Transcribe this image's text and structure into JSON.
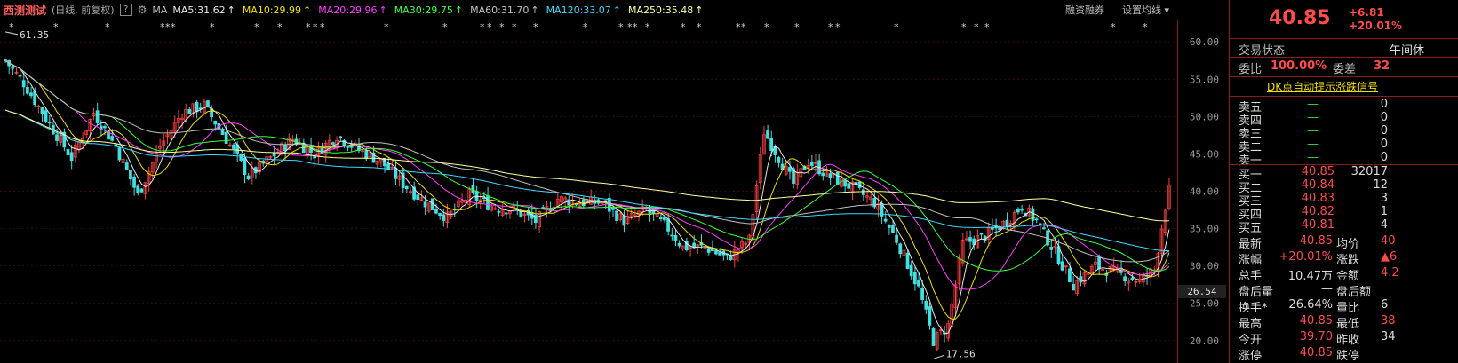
{
  "header": {
    "stock_name": "西测测试",
    "period": "(日线, 前复权)",
    "help": "?",
    "ma_label": "MA",
    "ma_items": [
      {
        "text": "MA5:31.62",
        "color": "#e8e8e8"
      },
      {
        "text": "MA10:29.99",
        "color": "#f0e000"
      },
      {
        "text": "MA20:29.96",
        "color": "#ff3cff"
      },
      {
        "text": "MA30:29.75",
        "color": "#3cff3c"
      },
      {
        "text": "MA60:31.70",
        "color": "#c0c0c0"
      },
      {
        "text": "MA120:33.07",
        "color": "#3cd8ff"
      },
      {
        "text": "MA250:35.48",
        "color": "#ffff9a"
      }
    ],
    "up_arrow": "↑",
    "margin_trading": "融资融券",
    "set_ma": "设置均线",
    "dropdown": "▾"
  },
  "chart_data": {
    "type": "candlestick",
    "ylim": [
      17,
      63
    ],
    "y_ticks": [
      "60.00",
      "55.00",
      "50.00",
      "45.00",
      "40.00",
      "35.00",
      "30.00",
      "25.00",
      "20.00"
    ],
    "current_price_label": "26.54",
    "high_annotation": "61.35",
    "low_annotation": "17.56",
    "event_marker": "*",
    "ma_series": [
      {
        "name": "MA5",
        "color": "#e8e8e8"
      },
      {
        "name": "MA10",
        "color": "#f0e000"
      },
      {
        "name": "MA20",
        "color": "#ff3cff"
      },
      {
        "name": "MA30",
        "color": "#3cff3c"
      },
      {
        "name": "MA60",
        "color": "#c0c0c0"
      },
      {
        "name": "MA120",
        "color": "#3cd8ff"
      },
      {
        "name": "MA250",
        "color": "#ffff9a"
      }
    ],
    "price_path": [
      [
        0,
        57.5
      ],
      [
        5,
        54.5
      ],
      [
        12,
        49
      ],
      [
        18,
        44.5
      ],
      [
        24,
        50.5
      ],
      [
        30,
        46
      ],
      [
        36,
        39.5
      ],
      [
        42,
        46
      ],
      [
        48,
        50.5
      ],
      [
        54,
        51.5
      ],
      [
        60,
        47
      ],
      [
        66,
        42
      ],
      [
        72,
        44.5
      ],
      [
        78,
        47
      ],
      [
        84,
        45
      ],
      [
        90,
        47.5
      ],
      [
        96,
        45.5
      ],
      [
        102,
        44
      ],
      [
        108,
        41
      ],
      [
        114,
        38.5
      ],
      [
        120,
        36.5
      ],
      [
        126,
        39.5
      ],
      [
        132,
        38
      ],
      [
        138,
        37.5
      ],
      [
        144,
        36
      ],
      [
        150,
        39
      ],
      [
        156,
        38.5
      ],
      [
        162,
        38.5
      ],
      [
        168,
        36
      ],
      [
        174,
        37.5
      ],
      [
        180,
        35
      ],
      [
        184,
        32.5
      ],
      [
        190,
        32.5
      ],
      [
        196,
        31
      ],
      [
        202,
        33.5
      ],
      [
        206,
        48
      ],
      [
        210,
        44.5
      ],
      [
        214,
        41
      ],
      [
        218,
        44
      ],
      [
        224,
        42
      ],
      [
        230,
        40.5
      ],
      [
        236,
        38.5
      ],
      [
        242,
        33.5
      ],
      [
        248,
        27
      ],
      [
        252,
        20
      ],
      [
        256,
        22
      ],
      [
        260,
        33
      ],
      [
        266,
        34
      ],
      [
        272,
        36
      ],
      [
        276,
        38
      ],
      [
        280,
        36
      ],
      [
        286,
        31
      ],
      [
        290,
        27.5
      ],
      [
        296,
        30
      ],
      [
        302,
        29
      ],
      [
        308,
        28
      ],
      [
        312,
        29.5
      ],
      [
        316,
        40.85
      ]
    ]
  },
  "panel": {
    "price": "40.85",
    "change": "+6.81",
    "change_pct": "+20.01%",
    "status_label": "交易状态",
    "status_value": "午间休",
    "wb_label": "委比",
    "wb_value": "100.00%",
    "wc_label": "委差",
    "wc_value": "32",
    "dk_link": "DK点自动提示涨跌信号",
    "asks": [
      {
        "label": "卖五",
        "price": "—",
        "vol": "0"
      },
      {
        "label": "卖四",
        "price": "—",
        "vol": "0"
      },
      {
        "label": "卖三",
        "price": "—",
        "vol": "0"
      },
      {
        "label": "卖二",
        "price": "—",
        "vol": "0"
      },
      {
        "label": "卖一",
        "price": "—",
        "vol": "0"
      }
    ],
    "bids": [
      {
        "label": "买一",
        "price": "40.85",
        "vol": "32017"
      },
      {
        "label": "买二",
        "price": "40.84",
        "vol": "12"
      },
      {
        "label": "买三",
        "price": "40.83",
        "vol": "3"
      },
      {
        "label": "买四",
        "price": "40.82",
        "vol": "1"
      },
      {
        "label": "买五",
        "price": "40.81",
        "vol": "4"
      }
    ],
    "stats": [
      {
        "l1": "最新",
        "v1": "40.85",
        "c1": "red",
        "l2": "均价",
        "v2": "40",
        "c2": "red"
      },
      {
        "l1": "涨幅",
        "v1": "+20.01%",
        "c1": "red",
        "l2": "涨跌",
        "v2": "▲6",
        "c2": "red"
      },
      {
        "l1": "总手",
        "v1": "10.47万",
        "c1": "white",
        "l2": "金额",
        "v2": "4.2",
        "c2": "red"
      },
      {
        "l1": "盘后量",
        "v1": "—",
        "c1": "white",
        "l2": "盘后额",
        "v2": "",
        "c2": "white"
      },
      {
        "l1": "换手*",
        "v1": "26.64%",
        "c1": "white",
        "l2": "量比",
        "v2": "6",
        "c2": "white"
      },
      {
        "l1": "最高",
        "v1": "40.85",
        "c1": "red",
        "l2": "最低",
        "v2": "38",
        "c2": "red"
      },
      {
        "l1": "今开",
        "v1": "39.70",
        "c1": "red",
        "l2": "昨收",
        "v2": "34",
        "c2": "white"
      },
      {
        "l1": "涨停",
        "v1": "40.85",
        "c1": "red",
        "l2": "跌停",
        "v2": "",
        "c2": "green"
      }
    ]
  }
}
